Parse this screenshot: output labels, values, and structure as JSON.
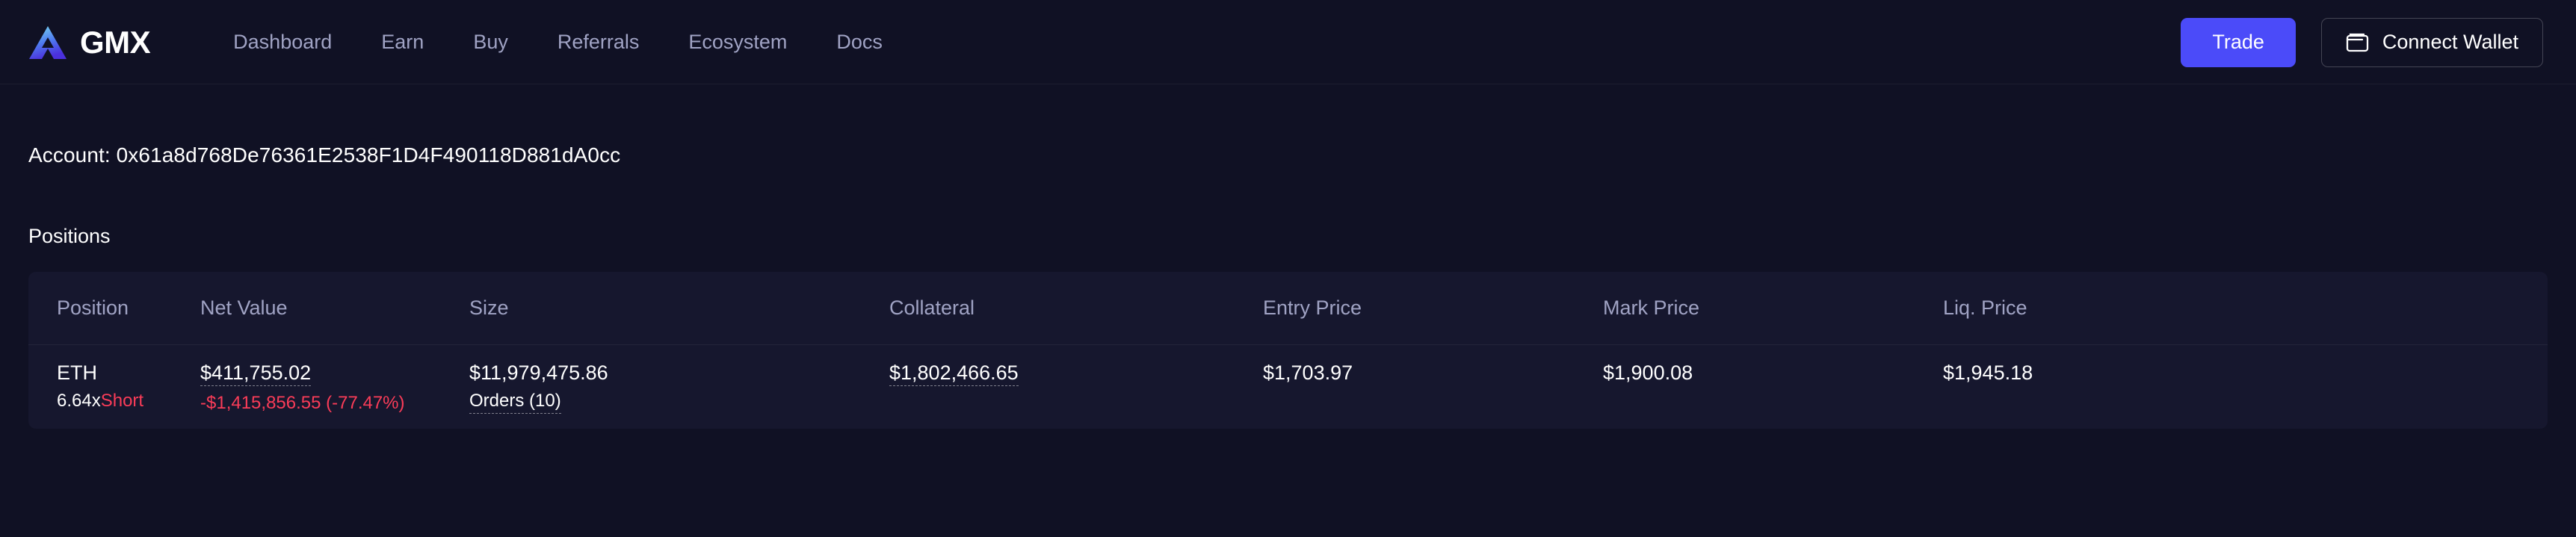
{
  "header": {
    "brand": {
      "name": "GMX",
      "logo_icon": "gmx-triangle-logo"
    },
    "nav": [
      {
        "label": "Dashboard"
      },
      {
        "label": "Earn"
      },
      {
        "label": "Buy"
      },
      {
        "label": "Referrals"
      },
      {
        "label": "Ecosystem"
      },
      {
        "label": "Docs"
      }
    ],
    "trade_button": "Trade",
    "connect_wallet_button": "Connect Wallet",
    "wallet_icon": "wallet-icon",
    "accent_color": "#4b4bf9"
  },
  "account": {
    "label": "Account:",
    "address": "0x61a8d768De76361E2538F1D4F490118D881dA0cc",
    "full_line": "Account: 0x61a8d768De76361E2538F1D4F490118D881dA0cc"
  },
  "positions": {
    "title": "Positions",
    "columns": [
      "Position",
      "Net Value",
      "Size",
      "Collateral",
      "Entry Price",
      "Mark Price",
      "Liq. Price"
    ],
    "rows": [
      {
        "token": "ETH",
        "leverage": "6.64x",
        "direction": "Short",
        "direction_color": "#fa3c58",
        "net_value": "$411,755.02",
        "pnl": "-$1,415,856.55 (-77.47%)",
        "pnl_color": "#fa3c58",
        "size": "$11,979,475.86",
        "orders": "Orders (10)",
        "collateral": "$1,802,466.65",
        "entry_price": "$1,703.97",
        "mark_price": "$1,900.08",
        "liq_price": "$1,945.18"
      }
    ]
  }
}
